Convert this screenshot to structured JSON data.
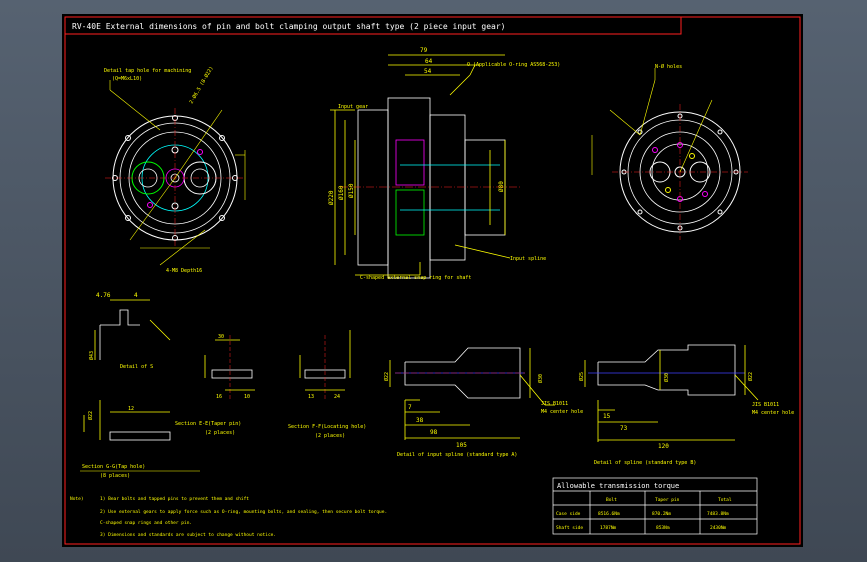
{
  "title": "RV-40E  External dimensions of pin and bolt clamping output shaft type (2 piece input gear)",
  "labels": {
    "detail_tap": "Detail tap hole for machining",
    "tap_spec": "(Q=M6xL10)",
    "angle1": "2-Ø6.5 (8-Ø22)",
    "bolt_holes": "4-M8 Depth16",
    "o_ring": "O (Applicable O-ring AS568-253)",
    "input_gear": "Input gear",
    "c_shaped": "C-shaped external snap ring for shaft",
    "input_spline": "Input spline",
    "n_note": "N-Ø holes",
    "detail_s": "Detail of S",
    "section_e": "Section E-E(Taper pin)",
    "e_places": "(2 places)",
    "section_f": "Section F-F(Locating hole)",
    "f_places": "(2 places)",
    "section_g": "Section G-G(Tap hole)",
    "g_places": "(8 places)",
    "detail_spline_a": "Detail of input spline (standard type A)",
    "detail_spline_b": "Detail of spline (standard type B)",
    "jis": "JIS B1011",
    "center_hole": "M4 center hole",
    "dim_79": "79",
    "dim_64": "64",
    "dim_54": "54",
    "dim_105": "105",
    "dim_120": "120",
    "dim_98": "98",
    "dim_73": "73",
    "dim_38": "38",
    "dim_30": "30",
    "dim_16": "16",
    "dim_10": "10",
    "dim_7": "7",
    "dim_15": "15",
    "dim_12": "12",
    "dim_13": "13",
    "dim_24": "24",
    "dim_25": "25",
    "dim_4_76": "4.76",
    "dim_4": "4",
    "dim_phi22": "Ø22",
    "dim_phi25": "Ø25",
    "dim_phi30": "Ø30",
    "dim_phi43": "Ø43",
    "dim_phi150": "Ø150",
    "dim_phi80": "Ø80",
    "dim_phi160": "Ø160",
    "dim_phi220": "Ø220"
  },
  "notes": {
    "label": "Note)",
    "n1": "1) Bear bolts and tapped pins to prevent them and shift",
    "n2": "2) Use external gears to apply force such as O-ring, mounting bolts, and sealing, then secure bolt torque.",
    "n3": "    C-shaped snap rings and other pin.",
    "n4": "3) Dimensions and standards are subject to change without notice."
  },
  "torque_table": {
    "title": "Allowable transmission torque",
    "headers": [
      "",
      "Bolt",
      "Taper pin",
      "Total"
    ],
    "rows": [
      [
        "Case side",
        "8516.6Nm",
        "870.2Nm",
        "7483.8Nm"
      ],
      [
        "Shaft side",
        "1787Nm",
        "853Nm",
        "2430Nm"
      ]
    ]
  },
  "colors": {
    "white": "#ffffff",
    "yellow": "#ffff00",
    "cyan": "#00ffff",
    "magenta": "#ff00ff",
    "red": "#ff2020",
    "green": "#00ff00",
    "blue": "#4040ff"
  }
}
